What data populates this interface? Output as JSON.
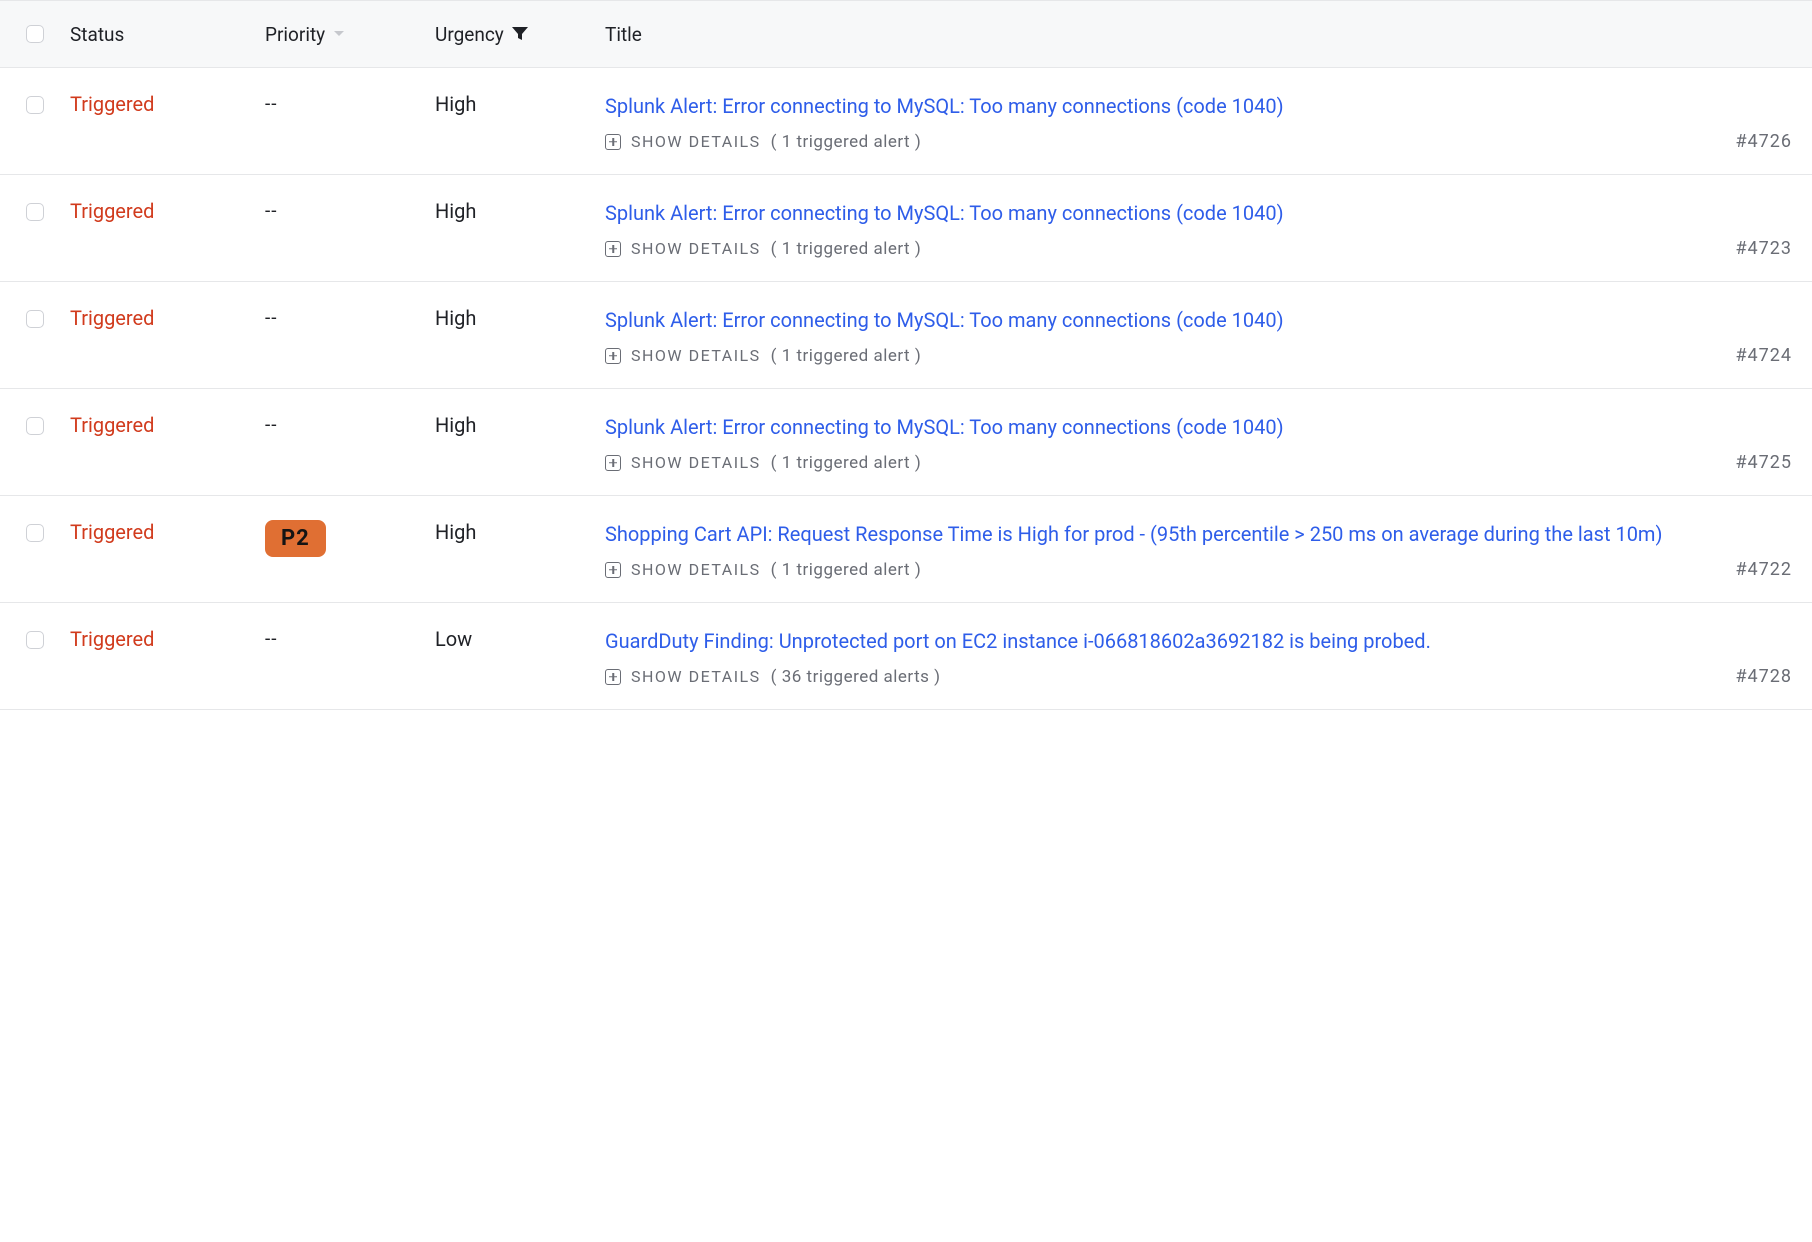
{
  "columns": {
    "status": "Status",
    "priority": "Priority",
    "urgency": "Urgency",
    "title": "Title"
  },
  "labels": {
    "show_details": "SHOW DETAILS",
    "priority_empty": "--"
  },
  "incidents": [
    {
      "status": "Triggered",
      "priority": null,
      "urgency": "High",
      "title": "Splunk Alert: Error connecting to MySQL: Too many connections (code 1040)",
      "alert_count_text": "( 1 triggered alert )",
      "id": "#4726"
    },
    {
      "status": "Triggered",
      "priority": null,
      "urgency": "High",
      "title": "Splunk Alert: Error connecting to MySQL: Too many connections (code 1040)",
      "alert_count_text": "( 1 triggered alert )",
      "id": "#4723"
    },
    {
      "status": "Triggered",
      "priority": null,
      "urgency": "High",
      "title": "Splunk Alert: Error connecting to MySQL: Too many connections (code 1040)",
      "alert_count_text": "( 1 triggered alert )",
      "id": "#4724"
    },
    {
      "status": "Triggered",
      "priority": null,
      "urgency": "High",
      "title": "Splunk Alert: Error connecting to MySQL: Too many connections (code 1040)",
      "alert_count_text": "( 1 triggered alert )",
      "id": "#4725"
    },
    {
      "status": "Triggered",
      "priority": "P2",
      "urgency": "High",
      "title": "Shopping Cart API: Request Response Time is High for prod - (95th percentile > 250 ms on average during the last 10m)",
      "alert_count_text": "( 1 triggered alert )",
      "id": "#4722"
    },
    {
      "status": "Triggered",
      "priority": null,
      "urgency": "Low",
      "title": "GuardDuty Finding: Unprotected port on EC2 instance i-066818602a3692182 is being probed.",
      "alert_count_text": "( 36 triggered alerts )",
      "id": "#4728"
    }
  ]
}
